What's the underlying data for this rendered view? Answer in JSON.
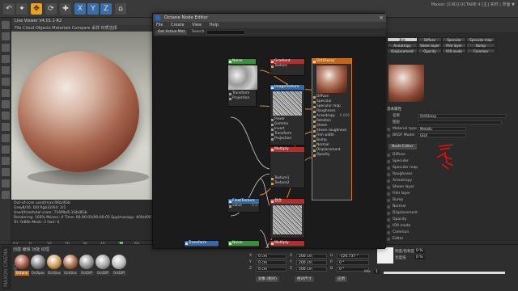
{
  "topbar": {
    "buttons": [
      "↶",
      "✦",
      "✥",
      "⟳",
      "✚",
      "X",
      "Y",
      "Z",
      "⌂"
    ],
    "right_text": "Maxon: [C4D] OCTANE 4 [主] 实时 | 界面 ▼"
  },
  "viewport": {
    "title": "Live Viewer V4.01.1-R2",
    "menu": "File  Cloud  Objects  Materials  Compare  采样 材质选择",
    "stats": [
      "Out-of-core used/max:0Kb/4Gb",
      "Grey8/16: 0/0        Rgb32/64: 2/1",
      "Used/free/total vram: 716Mb/6.1Gb/8Gb",
      "Rendering: 100%   Ms/sec: 0   Time: 00:00:05/00:00:05   Spp/maxspp: 400/400   Tri: 0/80k   Mesh: 2   Hair: 0"
    ]
  },
  "timeline": {
    "ticks": [
      "0",
      "10",
      "20",
      "30",
      "40",
      "50",
      "60"
    ],
    "frame_left": "0 F",
    "frame_right": "0 F"
  },
  "materials": {
    "menu": "创建  编辑  功能  纹理",
    "items": [
      "Octane",
      "OctSpec",
      "OctGlos",
      "OctGlos",
      "OctDiff",
      "OctDiff",
      "OctDiff"
    ]
  },
  "logo": "MAXON CINEMA 4D",
  "coords": {
    "rows": [
      {
        "a": "X",
        "v1": "0 cm",
        "b": "X",
        "v2": "200 cm",
        "c": "H",
        "v3": "-120.737 °"
      },
      {
        "a": "Y",
        "v1": "0 cm",
        "b": "Y",
        "v2": "200 cm",
        "c": "P",
        "v3": "0 °"
      },
      {
        "a": "Z",
        "v1": "0 cm",
        "b": "Z",
        "v2": "200 cm",
        "c": "B",
        "v3": "0 °"
      }
    ],
    "mode1": "对象 (相对)",
    "mode2": "绝对尺寸",
    "apply": "应用"
  },
  "attr_bottom": {
    "row1": "明度/饱和度",
    "row1_val": "0 %",
    "row2": "亮度值",
    "row2_val": "0 %",
    "mix": "Mix",
    "mix_val": "1"
  },
  "node_editor": {
    "title": "Octane Node Editor",
    "menu": [
      "File",
      "Create",
      "View",
      "Help"
    ],
    "toolbar": {
      "add_btn": "Get Active Mat",
      "search_label": "Search"
    },
    "nodes": {
      "noise": {
        "title": "Noise",
        "rows": [
          "Transform",
          "Projection"
        ]
      },
      "gradient": {
        "title": "Gradient",
        "rows": [
          "Texture"
        ]
      },
      "imagetex": {
        "title": "ImageTexture",
        "rows": [
          "Power",
          "Gamma",
          "Invert",
          "Transform",
          "Projection"
        ]
      },
      "multiply": {
        "title": "Multiply",
        "rows": [
          "Texture1",
          "Texture2"
        ]
      },
      "material": {
        "title": "OctGlossy",
        "rows": [
          "Diffuse",
          "Specular",
          "Specular map",
          "Roughness",
          "Anisotropy",
          "Rotation",
          "Sheen",
          "Sheen roughness",
          "Film width",
          "Bump",
          "Normal",
          "Displacement",
          "Opacity"
        ],
        "anisotropy_val": "0.000"
      },
      "floattex": {
        "title": "FloatTexture",
        "rows": [
          "value"
        ],
        "val": "0.5"
      },
      "blend": {
        "title": "混合",
        "rows": []
      },
      "multiply2": {
        "title": "Multiply",
        "rows": []
      },
      "transform": {
        "title": "Transform",
        "rows": [
          "X Y"
        ]
      },
      "noise2": {
        "title": "Noise",
        "rows": []
      }
    }
  },
  "attr": {
    "tabs": [
      [
        "基本",
        "Diffuse",
        "Specular",
        "Specular map"
      ],
      [
        "Anisotropy",
        "Sheen layer",
        "Film layer",
        "Bump"
      ],
      [
        "Displacement",
        "Opacity",
        "IOR mode",
        "Common"
      ],
      [
        "Normal",
        "Edit"
      ]
    ],
    "section_title": "基本属性",
    "name_label": "名称",
    "name_value": "OctGlossy",
    "layer_label": "图层",
    "material_type_label": "Material type",
    "material_type_value": "Metallic",
    "brdf_label": "BRDF Model",
    "brdf_value": "GGX",
    "node_editor_btn": "Node Editor",
    "channels": [
      "Diffuse",
      "Specular",
      "Specular map",
      "Roughness",
      "Anisotropy",
      "Sheen layer",
      "Film layer",
      "Bump",
      "Normal",
      "Displacement",
      "Opacity",
      "IOR mode",
      "Common",
      "Editor"
    ]
  }
}
